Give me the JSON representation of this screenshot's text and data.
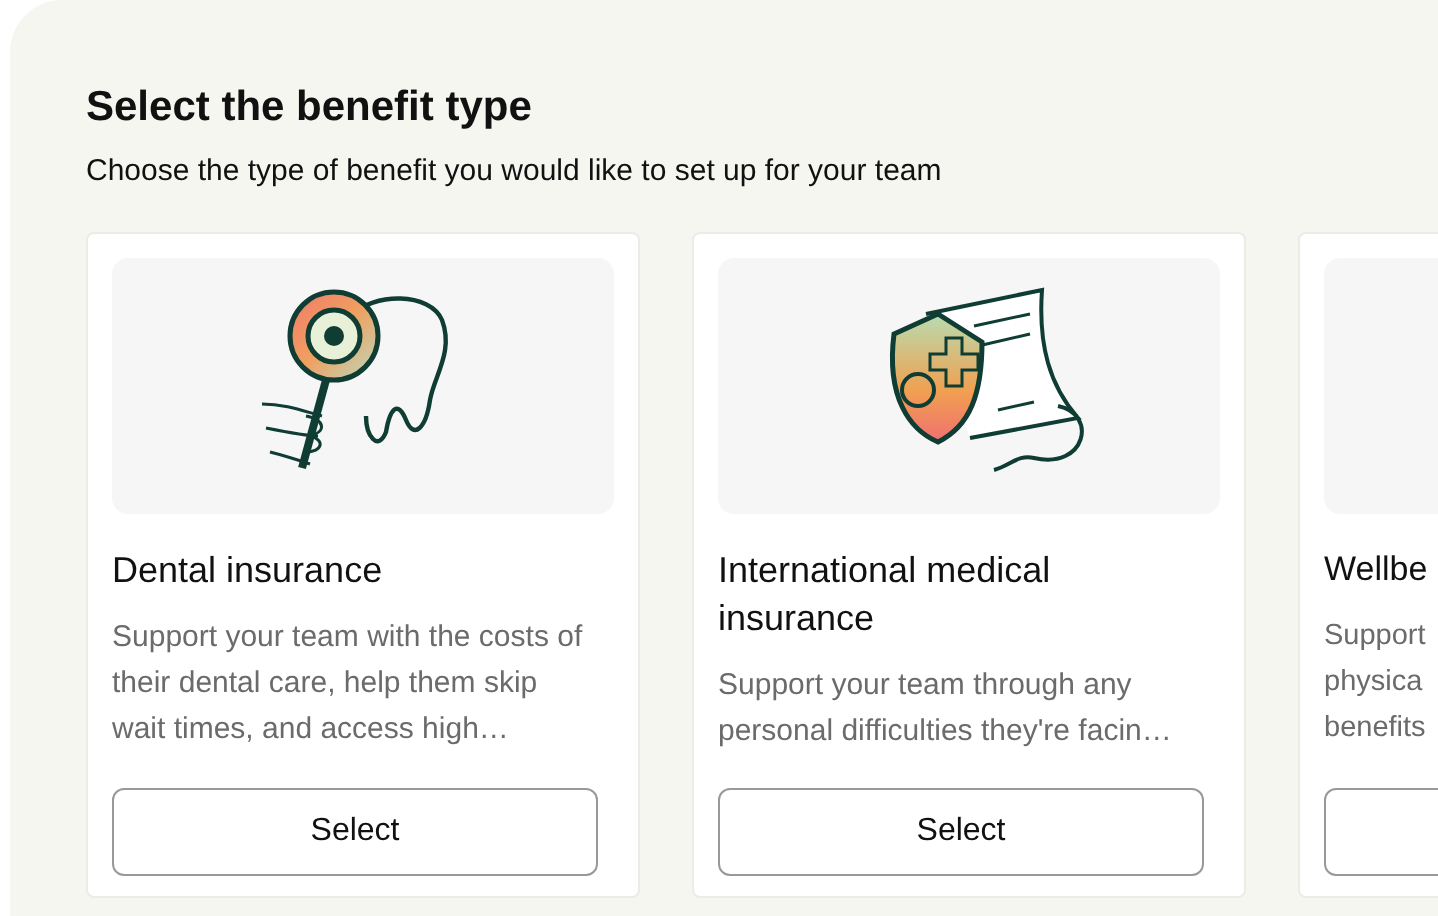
{
  "title": "Select the benefit type",
  "subtitle": "Choose the type of benefit you would like to set up for your team",
  "cards": [
    {
      "kind": "dental",
      "name": "Dental insurance",
      "description": "Support your team with the costs of their dental care, help them skip wait times, and access high…",
      "button": "Select"
    },
    {
      "kind": "medical",
      "name": "International medical insurance",
      "description": "Support your team through any personal difficulties they're facin…",
      "button": "Select"
    },
    {
      "kind": "blank",
      "name": "Wellbe",
      "description": "Support physica benefits"
    }
  ]
}
